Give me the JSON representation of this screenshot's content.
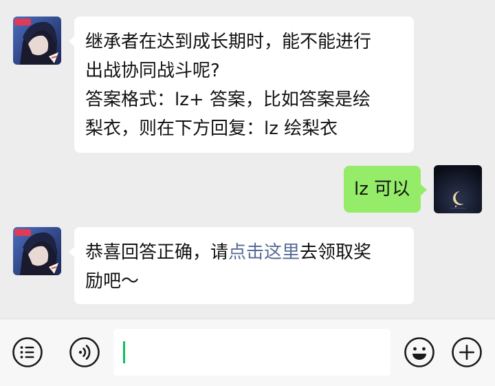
{
  "messages": [
    {
      "side": "left",
      "sender": "official-account",
      "lines": [
        "继承者在达到成长期时，能不能进行",
        "出战协同战斗呢?",
        "答案格式：lz+ 答案，比如答案是绘",
        "梨衣，则在下方回复：lz 绘梨衣"
      ]
    },
    {
      "side": "right",
      "sender": "me",
      "text": "lz 可以"
    },
    {
      "side": "left",
      "sender": "official-account",
      "line1_prefix": "恭喜回答正确，请",
      "link_text": "点击这里",
      "line1_suffix": "去领取奖",
      "line2": "励吧～"
    }
  ],
  "input": {
    "value": ""
  },
  "icons": {
    "voice": "voice-icon",
    "menu": "menu-icon",
    "emoji": "emoji-icon",
    "plus": "plus-icon"
  },
  "colors": {
    "bubble_out": "#95ec69",
    "link": "#576b95",
    "caret": "#07c160",
    "background": "#ededed"
  }
}
